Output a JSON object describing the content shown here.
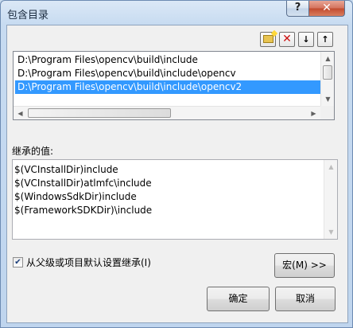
{
  "window": {
    "title": "包含目录"
  },
  "titlebar": {
    "help_label": "?",
    "close_label": "✕"
  },
  "toolbar": {
    "new_line_icon": "new-folder-icon",
    "delete_icon": "delete-icon",
    "delete_label": "✕",
    "move_down_icon": "arrow-down-icon",
    "move_down_label": "↓",
    "move_up_icon": "arrow-up-icon",
    "move_up_label": "↑"
  },
  "directories": {
    "items": [
      {
        "label": "D:\\Program Files\\opencv\\build\\include",
        "selected": false
      },
      {
        "label": "D:\\Program Files\\opencv\\build\\include\\opencv",
        "selected": false
      },
      {
        "label": "D:\\Program Files\\opencv\\build\\include\\opencv2",
        "selected": true
      }
    ]
  },
  "inherited": {
    "label": "继承的值:",
    "items": [
      "$(VCInstallDir)include",
      "$(VCInstallDir)atlmfc\\include",
      "$(WindowsSdkDir)include",
      "$(FrameworkSDKDir)\\include"
    ]
  },
  "inherit_checkbox": {
    "checked": true,
    "label": "从父级或项目默认设置继承(I)"
  },
  "buttons": {
    "macro": "宏(M) >>",
    "ok": "确定",
    "cancel": "取消"
  },
  "colors": {
    "selection": "#3399ff",
    "window_frame": "#c7dbf1",
    "close_button": "#c24a2e"
  }
}
